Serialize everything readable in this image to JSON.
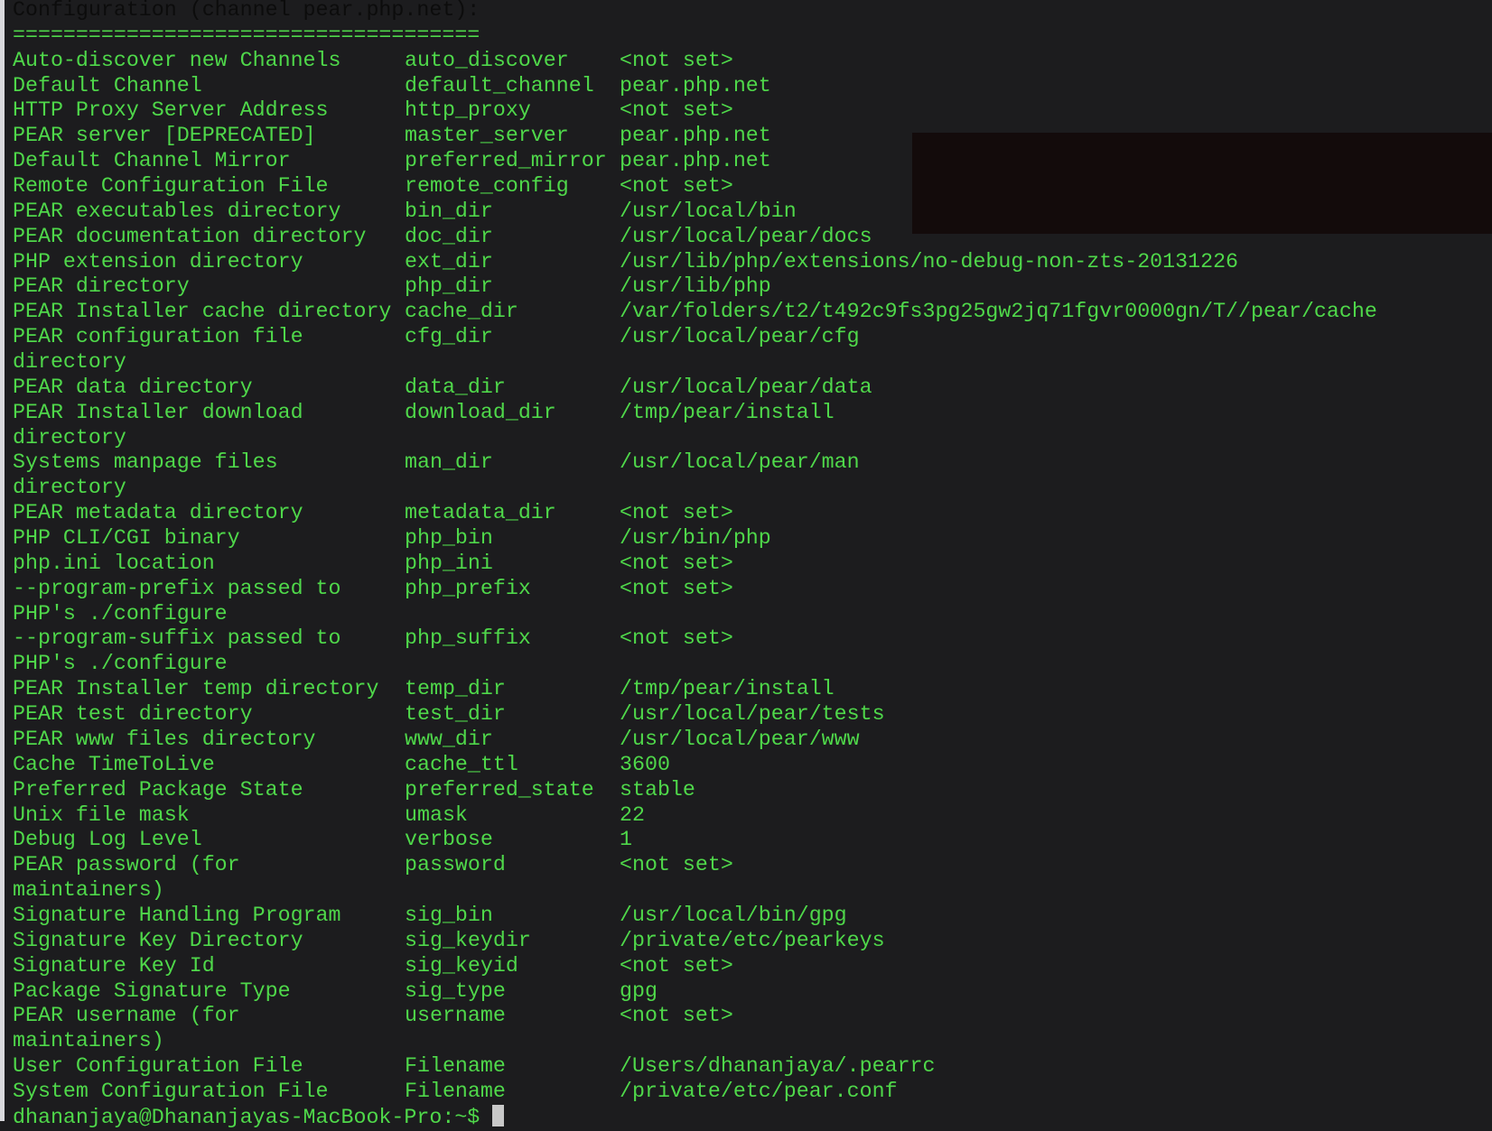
{
  "terminal": {
    "header": "Configuration (channel pear.php.net):",
    "separator": "=====================================",
    "rows": [
      {
        "label": "Auto-discover new Channels",
        "key": "auto_discover",
        "value": "<not set>"
      },
      {
        "label": "Default Channel",
        "key": "default_channel",
        "value": "pear.php.net"
      },
      {
        "label": "HTTP Proxy Server Address",
        "key": "http_proxy",
        "value": "<not set>"
      },
      {
        "label": "PEAR server [DEPRECATED]",
        "key": "master_server",
        "value": "pear.php.net"
      },
      {
        "label": "Default Channel Mirror",
        "key": "preferred_mirror",
        "value": "pear.php.net"
      },
      {
        "label": "Remote Configuration File",
        "key": "remote_config",
        "value": "<not set>"
      },
      {
        "label": "PEAR executables directory",
        "key": "bin_dir",
        "value": "/usr/local/bin"
      },
      {
        "label": "PEAR documentation directory",
        "key": "doc_dir",
        "value": "/usr/local/pear/docs"
      },
      {
        "label": "PHP extension directory",
        "key": "ext_dir",
        "value": "/usr/lib/php/extensions/no-debug-non-zts-20131226"
      },
      {
        "label": "PEAR directory",
        "key": "php_dir",
        "value": "/usr/lib/php"
      },
      {
        "label": "PEAR Installer cache directory",
        "key": "cache_dir",
        "value": "/var/folders/t2/t492c9fs3pg25gw2jq71fgvr0000gn/T//pear/cache"
      },
      {
        "label": "PEAR configuration file directory",
        "key": "cfg_dir",
        "value": "/usr/local/pear/cfg"
      },
      {
        "label": "PEAR data directory",
        "key": "data_dir",
        "value": "/usr/local/pear/data"
      },
      {
        "label": "PEAR Installer download directory",
        "key": "download_dir",
        "value": "/tmp/pear/install"
      },
      {
        "label": "Systems manpage files directory",
        "key": "man_dir",
        "value": "/usr/local/pear/man"
      },
      {
        "label": "PEAR metadata directory",
        "key": "metadata_dir",
        "value": "<not set>"
      },
      {
        "label": "PHP CLI/CGI binary",
        "key": "php_bin",
        "value": "/usr/bin/php"
      },
      {
        "label": "php.ini location",
        "key": "php_ini",
        "value": "<not set>"
      },
      {
        "label": "--program-prefix passed to PHP's ./configure",
        "key": "php_prefix",
        "value": "<not set>"
      },
      {
        "label": "--program-suffix passed to PHP's ./configure",
        "key": "php_suffix",
        "value": "<not set>"
      },
      {
        "label": "PEAR Installer temp directory",
        "key": "temp_dir",
        "value": "/tmp/pear/install"
      },
      {
        "label": "PEAR test directory",
        "key": "test_dir",
        "value": "/usr/local/pear/tests"
      },
      {
        "label": "PEAR www files directory",
        "key": "www_dir",
        "value": "/usr/local/pear/www"
      },
      {
        "label": "Cache TimeToLive",
        "key": "cache_ttl",
        "value": "3600"
      },
      {
        "label": "Preferred Package State",
        "key": "preferred_state",
        "value": "stable"
      },
      {
        "label": "Unix file mask",
        "key": "umask",
        "value": "22"
      },
      {
        "label": "Debug Log Level",
        "key": "verbose",
        "value": "1"
      },
      {
        "label": "PEAR password (for maintainers)",
        "key": "password",
        "value": "<not set>"
      },
      {
        "label": "Signature Handling Program",
        "key": "sig_bin",
        "value": "/usr/local/bin/gpg"
      },
      {
        "label": "Signature Key Directory",
        "key": "sig_keydir",
        "value": "/private/etc/pearkeys"
      },
      {
        "label": "Signature Key Id",
        "key": "sig_keyid",
        "value": "<not set>"
      },
      {
        "label": "Package Signature Type",
        "key": "sig_type",
        "value": "gpg"
      },
      {
        "label": "PEAR username (for maintainers)",
        "key": "username",
        "value": "<not set>"
      },
      {
        "label": "User Configuration File",
        "key": "Filename",
        "value": "/Users/dhananjaya/.pearrc"
      },
      {
        "label": "System Configuration File",
        "key": "Filename",
        "value": "/private/etc/pear.conf"
      }
    ],
    "prompt": "dhananjaya@Dhananjayas-MacBook-Pro:~$ "
  },
  "colors": {
    "background": "#1c1c1e",
    "text": "#4fd84a",
    "header_text": "#0c0c0c",
    "cursor": "#c8c8c8"
  }
}
